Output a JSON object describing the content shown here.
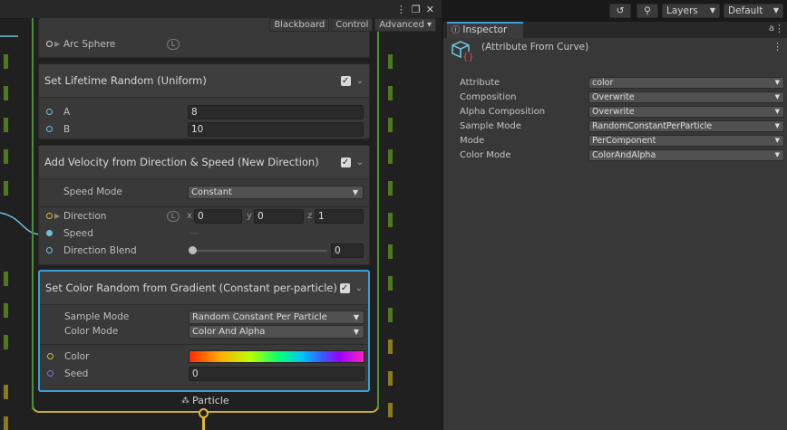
{
  "graph": {
    "window_icons": [
      "⋮",
      "❐",
      "✕"
    ],
    "toolbar": {
      "blackboard": "Blackboard",
      "control": "Control",
      "advanced": "Advanced ▾"
    },
    "context_label": "Particle"
  },
  "arc_sphere": {
    "label": "Arc Sphere",
    "space": "L"
  },
  "lifetime_block": {
    "title": "Set Lifetime Random (Uniform)",
    "a_label": "A",
    "a_value": "8",
    "b_label": "B",
    "b_value": "10"
  },
  "velocity_block": {
    "title": "Add Velocity from Direction & Speed (New Direction)",
    "speed_mode_label": "Speed Mode",
    "speed_mode_value": "Constant",
    "direction_label": "Direction",
    "space": "L",
    "dir_x_label": "x",
    "dir_x": "0",
    "dir_y_label": "y",
    "dir_y": "0",
    "dir_z_label": "z",
    "dir_z": "1",
    "speed_label": "Speed",
    "speed_placeholder": "---",
    "blend_label": "Direction Blend",
    "blend_value": "0",
    "blend_level": 0
  },
  "color_block": {
    "title": "Set Color Random from Gradient (Constant per-particle)",
    "sample_mode_label": "Sample Mode",
    "sample_mode_value": "Random Constant Per Particle",
    "color_mode_label": "Color Mode",
    "color_mode_value": "Color And Alpha",
    "color_label": "Color",
    "seed_label": "Seed",
    "seed_value": "0"
  },
  "inspector": {
    "tab": "Inspector",
    "top": {
      "history": "↺",
      "search": "⚲",
      "layers": "Layers",
      "layout": "Default"
    },
    "lock": "🔒",
    "menu": "⋮",
    "subject": "(Attribute From Curve)",
    "properties": [
      {
        "label": "Attribute",
        "value": "color"
      },
      {
        "label": "Composition",
        "value": "Overwrite"
      },
      {
        "label": "Alpha Composition",
        "value": "Overwrite"
      },
      {
        "label": "Sample Mode",
        "value": "RandomConstantPerParticle"
      },
      {
        "label": "Mode",
        "value": "PerComponent"
      },
      {
        "label": "Color Mode",
        "value": "ColorAndAlpha"
      }
    ]
  },
  "colors": {
    "selection": "#3aa0d8",
    "context_border": "#c8a93a",
    "flow_port": "#e0b73a",
    "vector_port": "#6fc0d8",
    "float_port": "#7b6fd8"
  }
}
